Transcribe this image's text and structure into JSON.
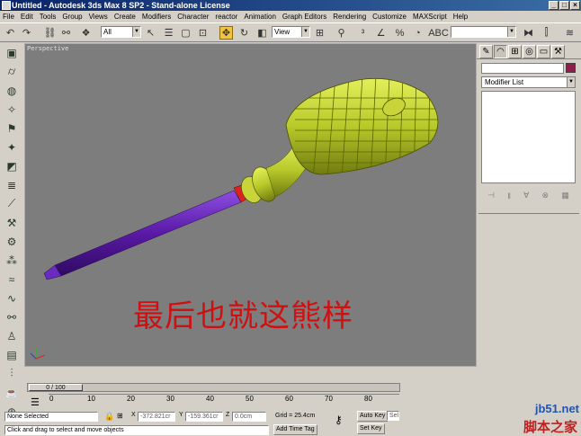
{
  "window": {
    "title": "Untitled - Autodesk 3ds Max 8 SP2 - Stand-alone License",
    "min": "_",
    "max": "□",
    "close": "×"
  },
  "menu": [
    "File",
    "Edit",
    "Tools",
    "Group",
    "Views",
    "Create",
    "Modifiers",
    "Character",
    "reactor",
    "Animation",
    "Graph Editors",
    "Rendering",
    "Customize",
    "MAXScript",
    "Help"
  ],
  "toolbar": {
    "selection_filter": "All",
    "ref_coord": "View",
    "named_sel": ""
  },
  "viewport": {
    "label": "Perspective",
    "overlay_text": "最后也就这熊样"
  },
  "command_panel": {
    "object_name": "",
    "color": "#8f1d4d",
    "modifier_list": "Modifier List"
  },
  "time": {
    "slider_label": "0 / 100",
    "ticks": [
      "0",
      "10",
      "20",
      "30",
      "40",
      "50",
      "60",
      "70",
      "80"
    ]
  },
  "status": {
    "selection": "None Selected",
    "prompt": "Click and drag to select and move objects",
    "x_label": "X",
    "x_value": "-372.821cr",
    "y_label": "Y",
    "y_value": "-159.361cr",
    "z_label": "Z",
    "z_value": "0.0cm",
    "grid": "Grid = 25.4cm",
    "add_time_tag": "Add Time Tag",
    "auto_key": "Auto Key",
    "set_key": "Set Key",
    "sel_box": "Sel"
  },
  "watermark": {
    "line1": "jb51.net",
    "line2": "脚本之家"
  },
  "colors": {
    "handle": "#b8c92a",
    "shaft": "#5a19a6",
    "ferrule": "#e02020",
    "viewport_bg": "#7d7d7d"
  }
}
